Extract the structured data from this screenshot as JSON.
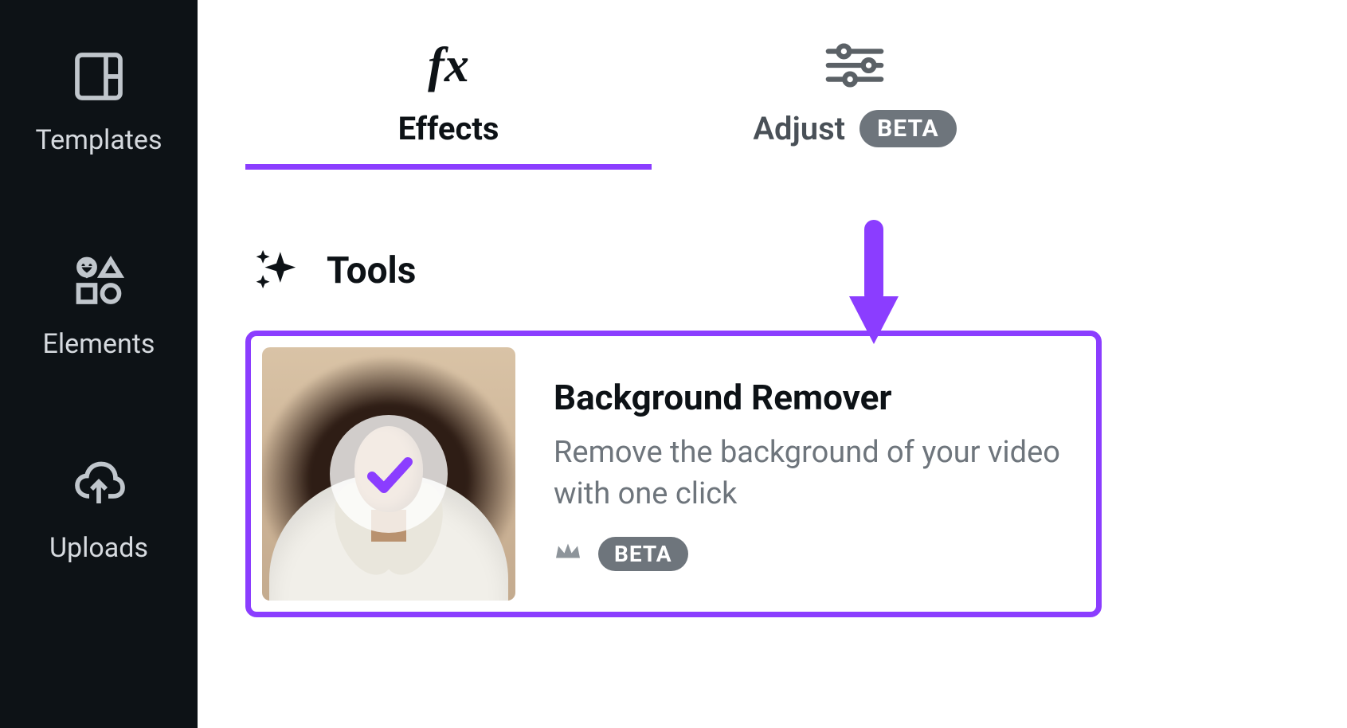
{
  "sidebar": {
    "items": [
      {
        "label": "Templates"
      },
      {
        "label": "Elements"
      },
      {
        "label": "Uploads"
      }
    ]
  },
  "tabs": {
    "effects": {
      "label": "Effects"
    },
    "adjust": {
      "label": "Adjust",
      "badge": "BETA"
    }
  },
  "tools": {
    "heading": "Tools",
    "card": {
      "title": "Background Remover",
      "description": "Remove the background of your video with one click",
      "badge": "BETA"
    }
  },
  "colors": {
    "accent": "#8b3dff"
  }
}
